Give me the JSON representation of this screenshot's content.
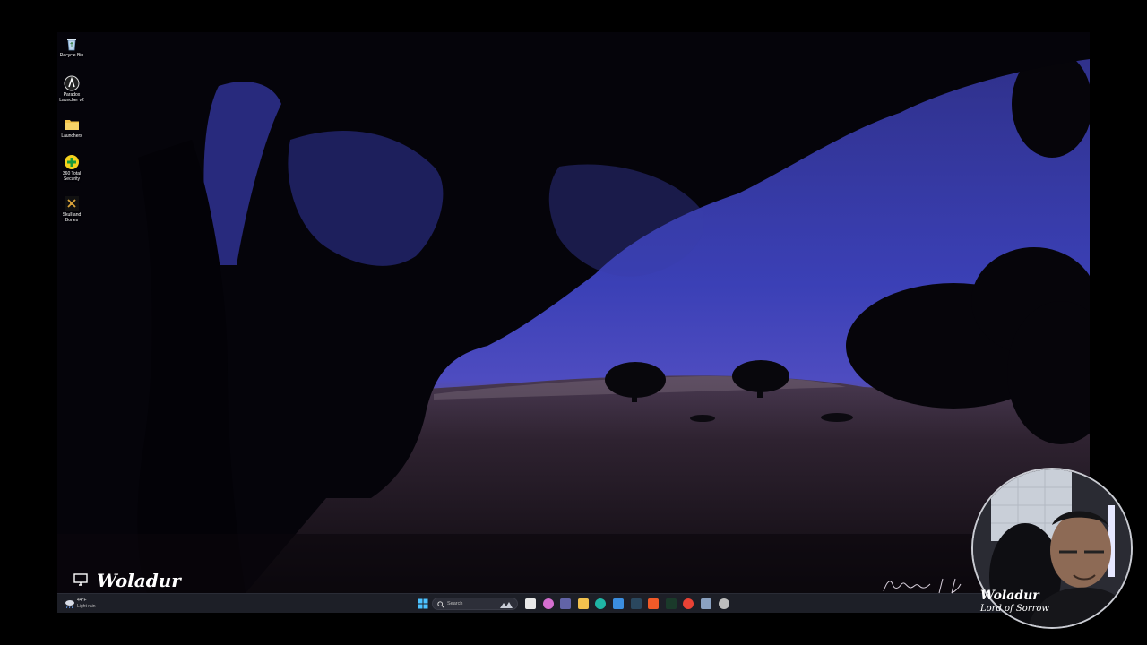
{
  "desktop": {
    "icons": [
      {
        "label": "Recycle Bin",
        "icon": "recycle-bin-icon"
      },
      {
        "label": "Paradox\nLauncher v2",
        "icon": "paradox-launcher-icon"
      },
      {
        "label": "Launchers",
        "icon": "folder-icon"
      },
      {
        "label": "360 Total\nSecurity",
        "icon": "360-security-icon"
      },
      {
        "label": "Skull and\nBones",
        "icon": "skull-and-bones-icon"
      }
    ]
  },
  "taskbar": {
    "weather": {
      "temp": "44°F",
      "condition": "Light rain",
      "icon": "rain-cloud-icon"
    },
    "search": {
      "placeholder": "Search"
    },
    "apps": [
      {
        "name": "task-view",
        "color": "#e8e8e8"
      },
      {
        "name": "copilot",
        "color": "#d56fd0"
      },
      {
        "name": "teams",
        "color": "#6264a7"
      },
      {
        "name": "file-explorer",
        "color": "#f2c14e"
      },
      {
        "name": "edge",
        "color": "#1fb5a5"
      },
      {
        "name": "store",
        "color": "#3b8ee0"
      },
      {
        "name": "steam",
        "color": "#2a475e"
      },
      {
        "name": "orange-app",
        "color": "#f05a28"
      },
      {
        "name": "terminal-app",
        "color": "#1a3a2a"
      },
      {
        "name": "chrome",
        "color": "#e94235"
      },
      {
        "name": "gear-app",
        "color": "#8aa1c1"
      },
      {
        "name": "browser-app",
        "color": "#bdbdbd"
      }
    ]
  },
  "overlay": {
    "streamer_name": "Woladur",
    "cam_name": "Woladur",
    "cam_subtitle": "Lord of Sorrow"
  },
  "colors": {
    "sky": "#3a40b0",
    "taskbar": "#1d1f27",
    "frame": "#000000"
  }
}
